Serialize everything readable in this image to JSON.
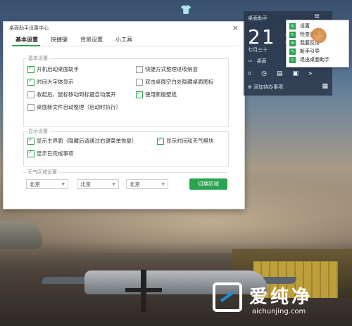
{
  "desktop": {
    "shirt_icon": "tshirt-icon"
  },
  "settings_window": {
    "title": "桌面助手设置中心",
    "close_glyph": "×",
    "tabs": [
      {
        "label": "基本设置",
        "active": true
      },
      {
        "label": "快捷键",
        "active": false
      },
      {
        "label": "背景设置",
        "active": false
      },
      {
        "label": "小工具",
        "active": false
      }
    ],
    "basic_group": {
      "title": "基本设置",
      "options": [
        {
          "label": "开机启动桌面助手",
          "checked": true
        },
        {
          "label": "快捷方式整理进收纳盒",
          "checked": false
        },
        {
          "label": "时间大字体显示",
          "checked": true
        },
        {
          "label": "双击桌面空白处隐藏桌面图标",
          "checked": false
        },
        {
          "label": "收起后，鼠标移动到标题自动展开",
          "checked": false
        },
        {
          "label": "使用新版壁纸",
          "checked": true
        },
        {
          "label": "桌面新文件自动整理（启动时执行）",
          "checked": false
        }
      ]
    },
    "display_group": {
      "title": "显示设置",
      "options": [
        {
          "label": "显示主界面（隐藏后请通过右键菜单恢复）",
          "checked": true
        },
        {
          "label": "显示时间和天气模块",
          "checked": true
        },
        {
          "label": "显示已完成事项",
          "checked": true
        }
      ]
    },
    "weather_group": {
      "title": "天气区域设置",
      "selects": [
        "北京",
        "北京",
        "北京"
      ],
      "switch_button": "切换区域"
    }
  },
  "widget": {
    "title": "桌面助手",
    "clock": "21 : 2",
    "date": "七月三十",
    "row_label": "桌面",
    "add_todo": "添加待办事项"
  },
  "context_menu": {
    "items": [
      {
        "label": "设置",
        "icon": "gear-icon"
      },
      {
        "label": "检查更新",
        "icon": "refresh-icon"
      },
      {
        "label": "我要反馈",
        "icon": "feedback-icon"
      },
      {
        "label": "新手引导",
        "icon": "guide-icon"
      },
      {
        "label": "退出桌面助手",
        "icon": "exit-icon"
      }
    ]
  },
  "watermark": {
    "brand": "爱纯净",
    "url": "aichunjing.com"
  },
  "colors": {
    "accent": "#2aa44f",
    "widget_bg": "#283448"
  }
}
